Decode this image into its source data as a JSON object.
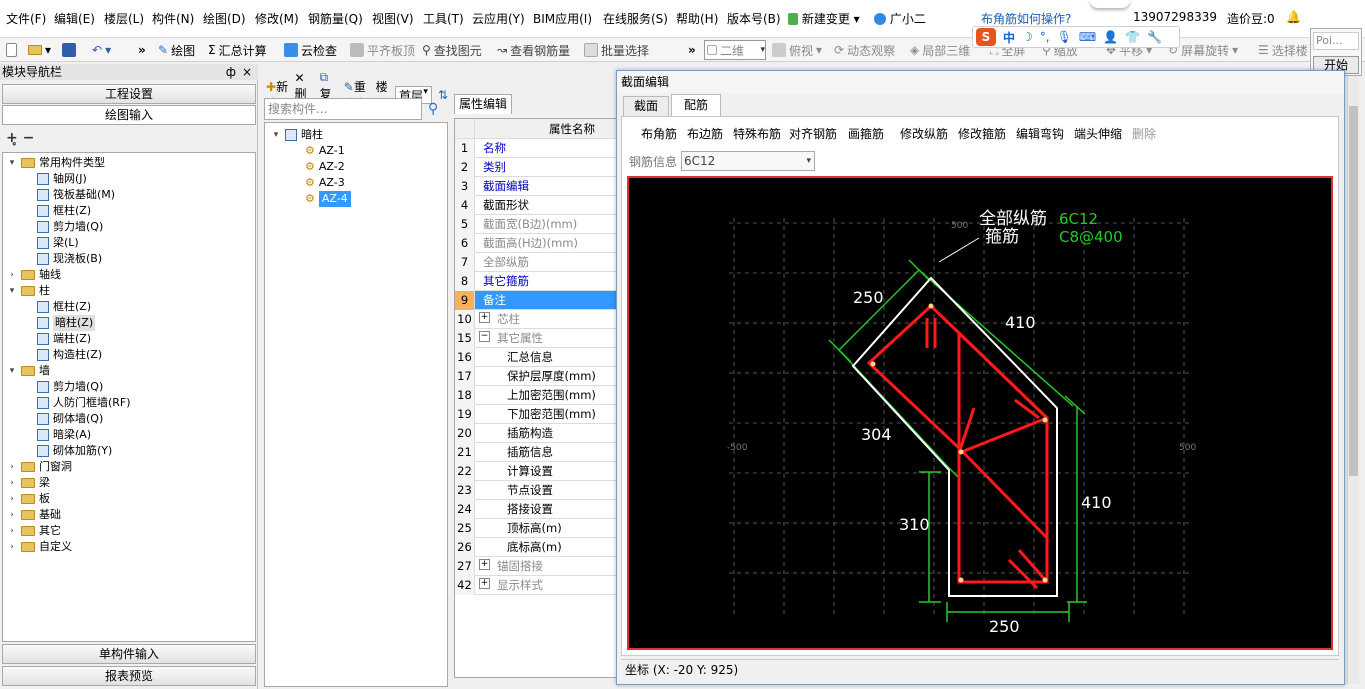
{
  "menu": {
    "items": [
      "文件(F)",
      "编辑(E)",
      "楼层(L)",
      "构件(N)",
      "绘图(D)",
      "修改(M)",
      "钢筋量(Q)",
      "视图(V)",
      "工具(T)",
      "云应用(Y)",
      "BIM应用(I)",
      "在线服务(S)",
      "帮助(H)",
      "版本号(B)",
      "新建变更",
      "广小二"
    ],
    "help_link": "布角筋如何操作?",
    "phone": "13907298339",
    "price_beans": "造价豆:0"
  },
  "toolbar": {
    "draw": "绘图",
    "sum_calc": "汇总计算",
    "cloud_check": "云检查",
    "flat_slab_top": "平齐板顶",
    "find_element": "查找图元",
    "view_rebar": "查看钢筋量",
    "batch_select": "批量选择",
    "view_2d": "二维",
    "top_view": "俯视",
    "dynamic_observe": "动态观察",
    "local_3d": "局部三维",
    "fullscreen": "全屏",
    "zoom": "缩放",
    "pan": "平移",
    "screen_rotate": "屏幕旋转",
    "select_floor": "选择楼"
  },
  "ime": {
    "letter": "S",
    "mode": "中"
  },
  "popup": {
    "input_value": "Poi...",
    "start_button": "开始"
  },
  "nav": {
    "title": "模块导航栏",
    "pin": "ф",
    "close": "×",
    "project_settings": "工程设置",
    "draw_input": "绘图输入",
    "single_input": "单构件输入",
    "report_preview": "报表预览",
    "tree": [
      {
        "label": "常用构件类型",
        "level": 0,
        "type": "folder",
        "expanded": true
      },
      {
        "label": "轴网(J)",
        "level": 1,
        "type": "item"
      },
      {
        "label": "筏板基础(M)",
        "level": 1,
        "type": "item"
      },
      {
        "label": "框柱(Z)",
        "level": 1,
        "type": "item"
      },
      {
        "label": "剪力墙(Q)",
        "level": 1,
        "type": "item"
      },
      {
        "label": "梁(L)",
        "level": 1,
        "type": "item"
      },
      {
        "label": "现浇板(B)",
        "level": 1,
        "type": "item"
      },
      {
        "label": "轴线",
        "level": 0,
        "type": "folder",
        "expanded": false
      },
      {
        "label": "柱",
        "level": 0,
        "type": "folder",
        "expanded": true
      },
      {
        "label": "框柱(Z)",
        "level": 1,
        "type": "item"
      },
      {
        "label": "暗柱(Z)",
        "level": 1,
        "type": "item",
        "selected": true
      },
      {
        "label": "端柱(Z)",
        "level": 1,
        "type": "item"
      },
      {
        "label": "构造柱(Z)",
        "level": 1,
        "type": "item"
      },
      {
        "label": "墙",
        "level": 0,
        "type": "folder",
        "expanded": true
      },
      {
        "label": "剪力墙(Q)",
        "level": 1,
        "type": "item"
      },
      {
        "label": "人防门框墙(RF)",
        "level": 1,
        "type": "item"
      },
      {
        "label": "砌体墙(Q)",
        "level": 1,
        "type": "item"
      },
      {
        "label": "暗梁(A)",
        "level": 1,
        "type": "item"
      },
      {
        "label": "砌体加筋(Y)",
        "level": 1,
        "type": "item"
      },
      {
        "label": "门窗洞",
        "level": 0,
        "type": "folder",
        "expanded": false
      },
      {
        "label": "梁",
        "level": 0,
        "type": "folder",
        "expanded": false
      },
      {
        "label": "板",
        "level": 0,
        "type": "folder",
        "expanded": false
      },
      {
        "label": "基础",
        "level": 0,
        "type": "folder",
        "expanded": false
      },
      {
        "label": "其它",
        "level": 0,
        "type": "folder",
        "expanded": false
      },
      {
        "label": "自定义",
        "level": 0,
        "type": "folder",
        "expanded": false
      }
    ]
  },
  "list": {
    "new": "新建",
    "delete": "删除",
    "copy": "复制",
    "rename": "重命名",
    "floor_label": "楼层",
    "floor_value": "首层",
    "search_placeholder": "搜索构件...",
    "root": "暗柱",
    "items": [
      "AZ-1",
      "AZ-2",
      "AZ-3",
      "AZ-4"
    ],
    "selected_index": 3
  },
  "props": {
    "tab": "属性编辑",
    "header": "属性名称",
    "rows": [
      {
        "num": "1",
        "name": "名称",
        "style": "blue"
      },
      {
        "num": "2",
        "name": "类别",
        "style": "blue"
      },
      {
        "num": "3",
        "name": "截面编辑",
        "style": "blue"
      },
      {
        "num": "4",
        "name": "截面形状",
        "style": "normal"
      },
      {
        "num": "5",
        "name": "截面宽(B边)(mm)",
        "style": "gray"
      },
      {
        "num": "6",
        "name": "截面高(H边)(mm)",
        "style": "gray"
      },
      {
        "num": "7",
        "name": "全部纵筋",
        "style": "gray"
      },
      {
        "num": "8",
        "name": "其它箍筋",
        "style": "blue"
      },
      {
        "num": "9",
        "name": "备注",
        "style": "selected"
      },
      {
        "num": "10",
        "name": "芯柱",
        "style": "gray",
        "expander": "+"
      },
      {
        "num": "15",
        "name": "其它属性",
        "style": "gray",
        "expander": "−"
      },
      {
        "num": "16",
        "name": "汇总信息",
        "style": "child"
      },
      {
        "num": "17",
        "name": "保护层厚度(mm)",
        "style": "child"
      },
      {
        "num": "18",
        "name": "上加密范围(mm)",
        "style": "child"
      },
      {
        "num": "19",
        "name": "下加密范围(mm)",
        "style": "child"
      },
      {
        "num": "20",
        "name": "插筋构造",
        "style": "child"
      },
      {
        "num": "21",
        "name": "插筋信息",
        "style": "child"
      },
      {
        "num": "22",
        "name": "计算设置",
        "style": "child"
      },
      {
        "num": "23",
        "name": "节点设置",
        "style": "child"
      },
      {
        "num": "24",
        "name": "搭接设置",
        "style": "child"
      },
      {
        "num": "25",
        "name": "顶标高(m)",
        "style": "child"
      },
      {
        "num": "26",
        "name": "底标高(m)",
        "style": "child"
      },
      {
        "num": "27",
        "name": "锚固搭接",
        "style": "gray",
        "expander": "+"
      },
      {
        "num": "42",
        "name": "显示样式",
        "style": "gray",
        "expander": "+"
      }
    ]
  },
  "dialog": {
    "title": "截面编辑",
    "tabs": [
      "截面",
      "配筋"
    ],
    "active_tab": 1,
    "rebar_tools": [
      "布角筋",
      "布边筋",
      "特殊布筋",
      "对齐钢筋",
      "画箍筋",
      "修改纵筋",
      "修改箍筋",
      "编辑弯钩",
      "端头伸缩",
      "删除"
    ],
    "rebar_info_label": "钢筋信息",
    "rebar_info_value": "6C12",
    "coords": "坐标 (X: -20 Y: 925)",
    "drawing": {
      "label_all_long": "全部纵筋",
      "value_all_long": "6C12",
      "label_stirrup": "箍筋",
      "value_stirrup": "C8@400",
      "dims": [
        "250",
        "410",
        "304",
        "410",
        "310",
        "250"
      ],
      "grid_labels": [
        "500",
        "-500",
        "500"
      ]
    }
  },
  "colors": {
    "selected_bg": "#3399ff",
    "rebar_red": "#ff1a1a",
    "dim_green": "#22cc22",
    "canvas_bg": "#000000",
    "label_blue": "#0000c0"
  }
}
